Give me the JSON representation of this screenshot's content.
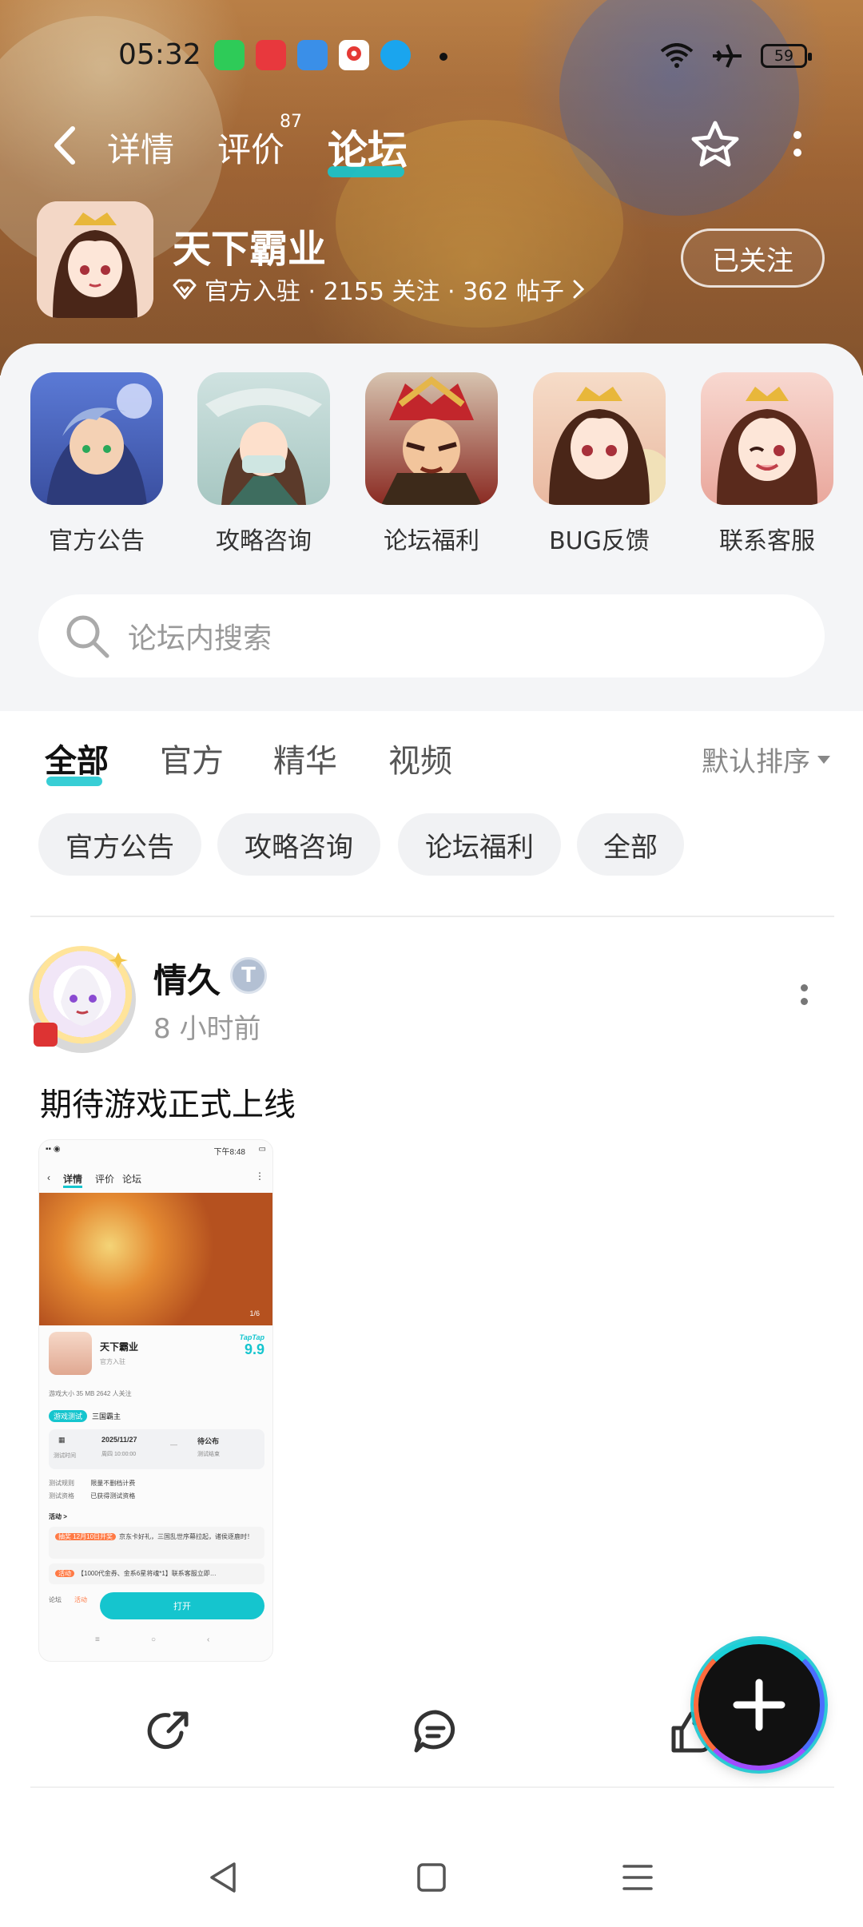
{
  "status_bar": {
    "time": "05:32",
    "battery": "59",
    "app_icons": [
      "app-store-icon",
      "news-app-icon",
      "weather-icon",
      "maps-icon",
      "qq-icon"
    ],
    "right_icons": [
      "wifi-icon",
      "airplane-icon",
      "battery-icon"
    ]
  },
  "nav": {
    "tabs": [
      {
        "label": "详情"
      },
      {
        "label": "评价",
        "badge": "87"
      },
      {
        "label": "论坛"
      }
    ],
    "active_tab": "论坛"
  },
  "game": {
    "title": "天下霸业",
    "meta": "官方入驻 · 2155 关注 · 362 帖子",
    "follow_label": "已关注"
  },
  "shortcuts": [
    {
      "label": "官方公告"
    },
    {
      "label": "攻略咨询"
    },
    {
      "label": "论坛福利"
    },
    {
      "label": "BUG反馈"
    },
    {
      "label": "联系客服"
    }
  ],
  "search": {
    "placeholder": "论坛内搜索"
  },
  "filter": {
    "tabs": [
      "全部",
      "官方",
      "精华",
      "视频"
    ],
    "active": "全部",
    "sort_label": "默认排序"
  },
  "chips": [
    "官方公告",
    "攻略咨询",
    "论坛福利",
    "全部"
  ],
  "post": {
    "author": "情久",
    "badge": "T",
    "time": "8 小时前",
    "title": "期待游戏正式上线",
    "screenshot": {
      "status_time": "下午8:48",
      "nav_tabs": [
        "详情",
        "评价",
        "论坛"
      ],
      "page_indicator": "1/6",
      "game_name": "天下霸业",
      "official": "官方入驻",
      "brand": "TapTap",
      "score": "9.9",
      "size_line": "游戏大小 35 MB    2642 人关注",
      "tag_pill": "游戏测试",
      "tag_text": "三国霸主",
      "test_date": "2025/11/27",
      "test_weekday": "周四 10:00:00",
      "test_start_label": "测试时间",
      "test_end": "待公布",
      "test_end_label": "测试结束",
      "rule_label": "测试规则",
      "rule_value": "限量不删档计费",
      "qual_label": "测试资格",
      "qual_value": "已获得测试资格",
      "activity_header": "活动 >",
      "activity_1_pill": "抽奖 12月10日开奖",
      "activity_1_text": "京东卡好礼，三国乱世序幕拉起，诸侯逐鹿时！",
      "activity_2_pill": "活动",
      "activity_2_text": "【1000代金券、金系6星将魂*1】联系客服立即…",
      "open_label": "打开",
      "icon_labels": [
        "论坛",
        "活动"
      ]
    }
  },
  "colors": {
    "accent": "#15c5ce",
    "banner": "#b8743d",
    "gray_bg": "#f4f5f7"
  }
}
